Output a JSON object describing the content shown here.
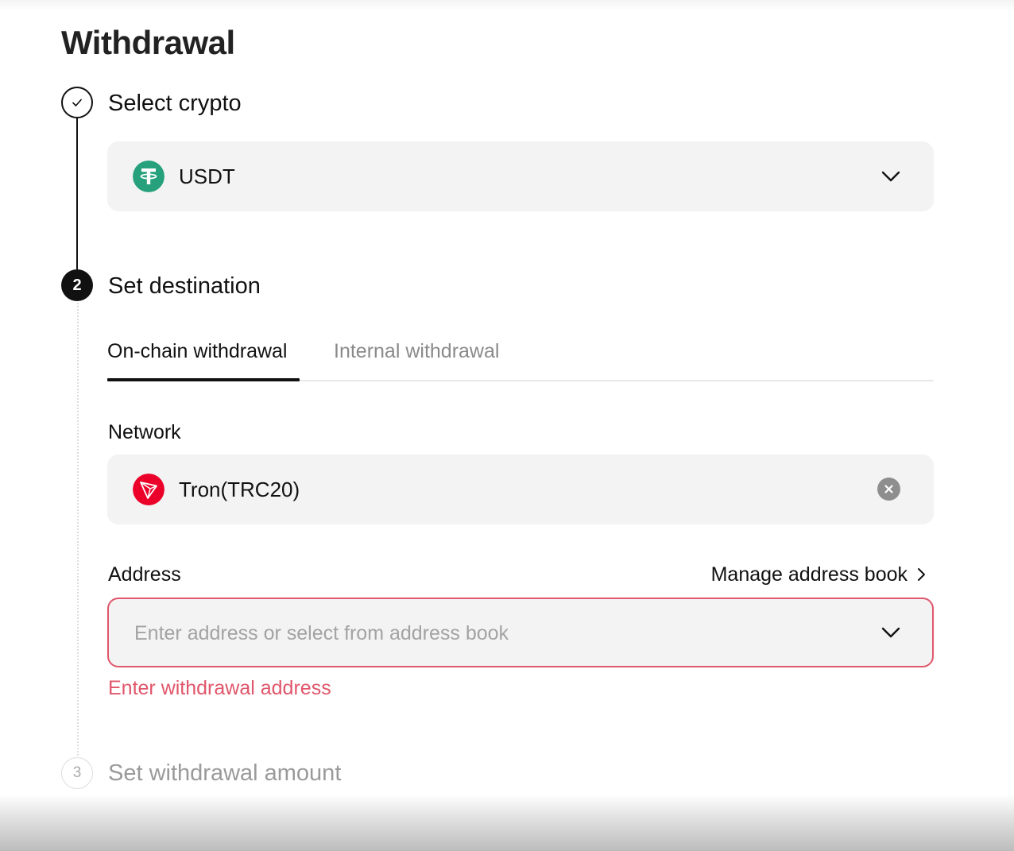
{
  "page": {
    "title": "Withdrawal"
  },
  "steps": [
    {
      "number": "1",
      "label": "Select crypto",
      "state": "done",
      "icon": "check-icon"
    },
    {
      "number": "2",
      "label": "Set destination",
      "state": "active"
    },
    {
      "number": "3",
      "label": "Set withdrawal amount",
      "state": "upcoming"
    }
  ],
  "crypto": {
    "selected": "USDT",
    "icon": "tether-icon",
    "icon_color": "#26a17b"
  },
  "tabs": [
    {
      "label": "On-chain withdrawal",
      "active": true
    },
    {
      "label": "Internal withdrawal",
      "active": false
    }
  ],
  "network": {
    "label": "Network",
    "selected": "Tron(TRC20)",
    "icon": "tron-icon",
    "icon_color": "#eb0029"
  },
  "address": {
    "label": "Address",
    "manage_link": "Manage address book",
    "placeholder": "Enter address or select from address book",
    "value": "",
    "error": "Enter withdrawal address",
    "error_color": "#e0566a"
  }
}
